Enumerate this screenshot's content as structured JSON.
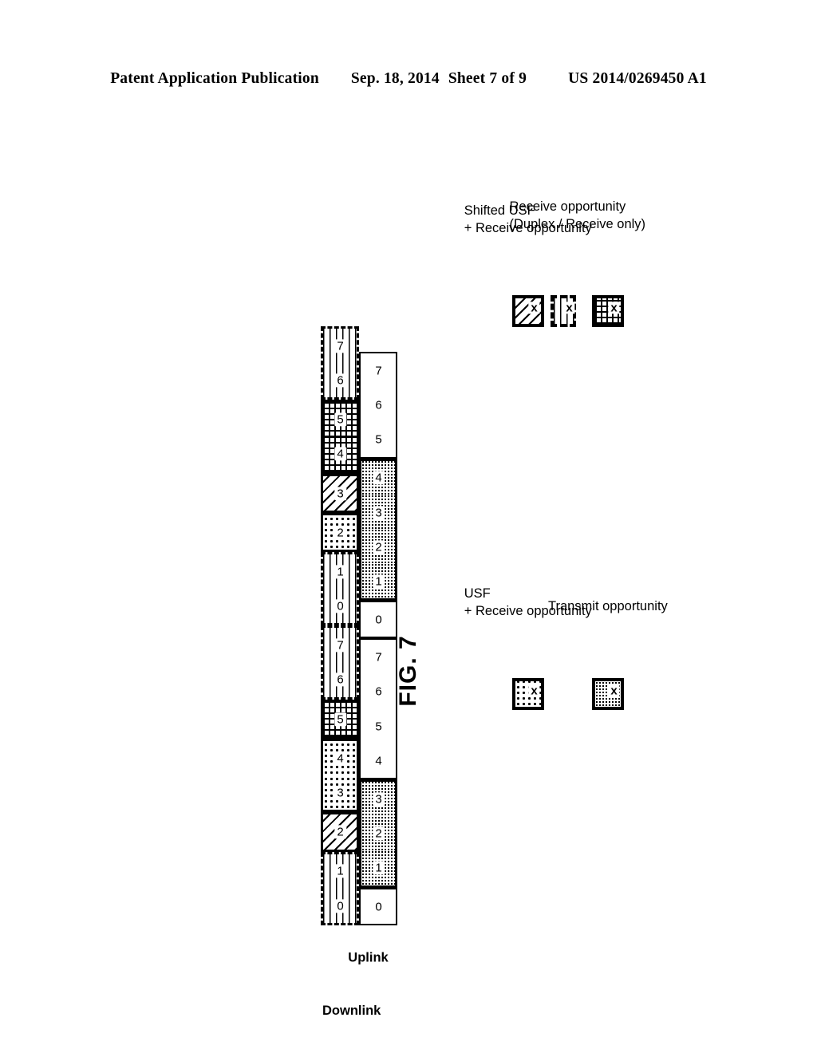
{
  "header": {
    "publication": "Patent Application Publication",
    "date": "Sep. 18, 2014",
    "sheet": "Sheet 7 of 9",
    "number": "US 2014/0269450 A1"
  },
  "figure": {
    "caption": "FIG. 7",
    "axis_labels": {
      "downlink": "Downlink",
      "uplink": "Uplink"
    },
    "downlink_row": {
      "label": "Downlink",
      "groups": [
        {
          "border": "dashed",
          "pattern": "horizontal-lines",
          "cells": [
            "0",
            "1"
          ]
        },
        {
          "border": "solid",
          "pattern": "diagonal-hatch",
          "cells": [
            "2"
          ]
        },
        {
          "border": "solid",
          "pattern": "sparse-dots",
          "cells": [
            "3",
            "4"
          ]
        },
        {
          "border": "solid",
          "pattern": "crosshatch-grid",
          "cells": [
            "5"
          ]
        },
        {
          "border": "dashed",
          "pattern": "horizontal-lines",
          "cells": [
            "6",
            "7"
          ]
        },
        {
          "border": "dashed",
          "pattern": "horizontal-lines",
          "cells": [
            "0",
            "1"
          ]
        },
        {
          "border": "solid",
          "pattern": "sparse-dots",
          "cells": [
            "2"
          ]
        },
        {
          "border": "solid",
          "pattern": "diagonal-hatch",
          "cells": [
            "3"
          ]
        },
        {
          "border": "solid",
          "pattern": "crosshatch-grid",
          "cells": [
            "4",
            "5"
          ]
        },
        {
          "border": "dashed",
          "pattern": "horizontal-lines",
          "cells": [
            "6",
            "7"
          ]
        }
      ]
    },
    "uplink_row": {
      "label": "Uplink",
      "groups": [
        {
          "border": "plain",
          "pattern": "white",
          "cells": [
            "0"
          ]
        },
        {
          "border": "solid",
          "pattern": "dense-dots",
          "cells": [
            "1",
            "2",
            "3"
          ]
        },
        {
          "border": "plain",
          "pattern": "white",
          "cells": [
            "4",
            "5",
            "6",
            "7"
          ]
        },
        {
          "border": "plain",
          "pattern": "white",
          "cells": [
            "0"
          ]
        },
        {
          "border": "solid",
          "pattern": "dense-dots",
          "cells": [
            "1",
            "2",
            "3",
            "4"
          ]
        },
        {
          "border": "plain",
          "pattern": "white",
          "cells": [
            "5",
            "6",
            "7"
          ]
        }
      ]
    },
    "legend": [
      {
        "id": "usf-receive",
        "line1": "USF",
        "line2": "+ Receive opportunity",
        "pattern": "sparse-dots",
        "border": "solid",
        "marker": "x"
      },
      {
        "id": "transmit",
        "line1": "Transmit opportunity",
        "line2": "",
        "pattern": "dense-dots",
        "border": "solid",
        "marker": "x"
      },
      {
        "id": "shifted-usf-receive",
        "line1": "Shifted USF",
        "line2": "+ Receive opportunity",
        "pattern": "diagonal-hatch",
        "border": "solid",
        "marker": "x"
      },
      {
        "id": "receive-duplex",
        "line1": "Receive opportunity",
        "line2": "(Duplex / Receive only)",
        "pattern_a": "horizontal-lines",
        "border_a": "dashed",
        "pattern_b": "crosshatch-grid",
        "border_b": "solid",
        "marker": "x"
      }
    ]
  }
}
